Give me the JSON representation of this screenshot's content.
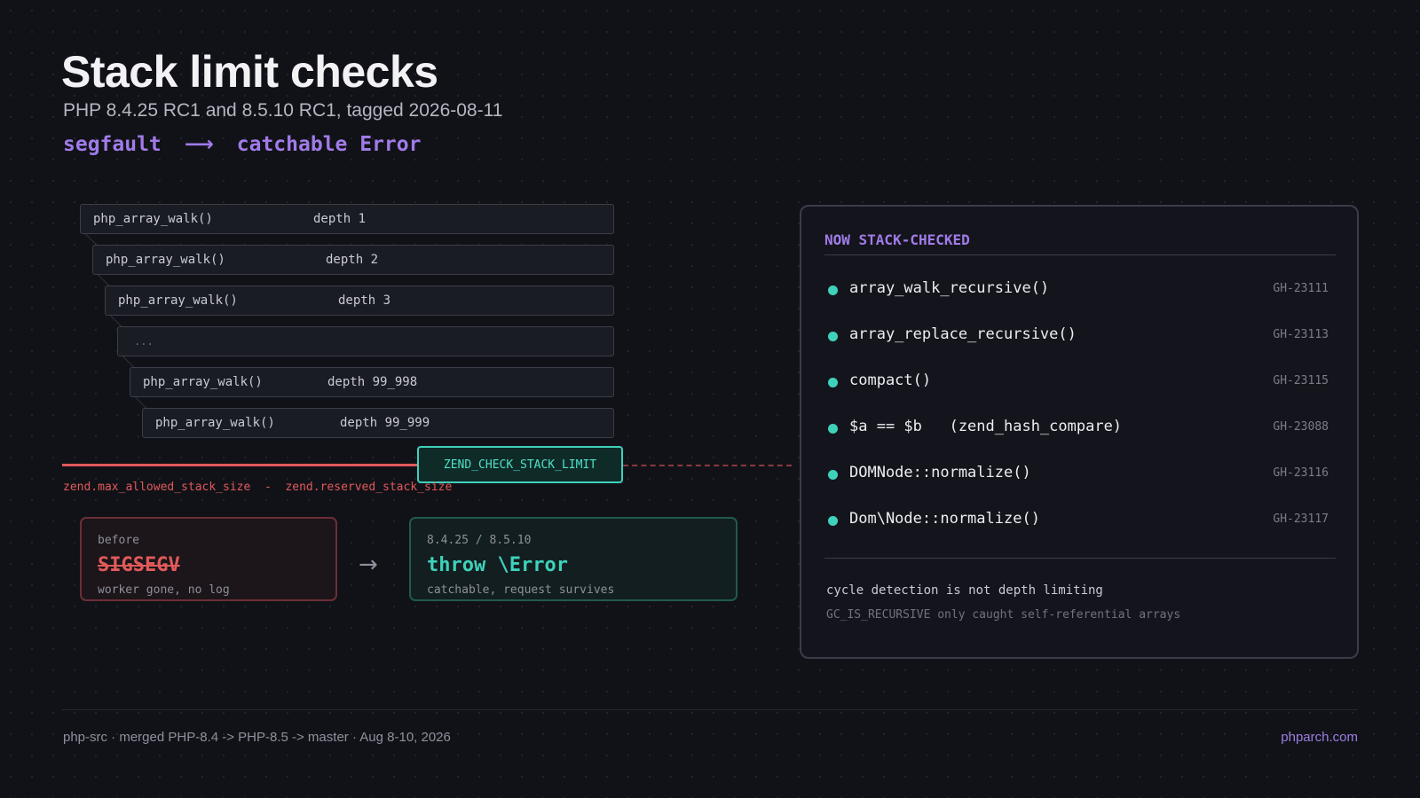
{
  "header": {
    "title": "Stack limit checks",
    "subtitle": "PHP 8.4.25 RC1 and 8.5.10 RC1, tagged 2026-08-11",
    "tagline_from": "segfault",
    "tagline_to": "catchable Error"
  },
  "stack": {
    "frames": [
      {
        "fn": "php_array_walk()",
        "depth": "depth 1"
      },
      {
        "fn": "php_array_walk()",
        "depth": "depth 2"
      },
      {
        "fn": "php_array_walk()",
        "depth": "depth 3"
      },
      {
        "fn": "...",
        "depth": ""
      },
      {
        "fn": "php_array_walk()",
        "depth": "depth 99_998"
      },
      {
        "fn": "php_array_walk()",
        "depth": "depth 99_999"
      }
    ]
  },
  "limit": {
    "label": "ZEND_CHECK_STACK_LIMIT",
    "formula": "zend.max_allowed_stack_size  -  zend.reserved_stack_size"
  },
  "before": {
    "label": "before",
    "value": "SIGSEGV",
    "note": "worker gone, no log"
  },
  "after": {
    "label": "8.4.25 / 8.5.10",
    "value": "throw \\Error",
    "note": "catchable, request survives"
  },
  "panel": {
    "title": "NOW STACK-CHECKED",
    "items": [
      {
        "name": "array_walk_recursive()",
        "ref": "GH-23111"
      },
      {
        "name": "array_replace_recursive()",
        "ref": "GH-23113"
      },
      {
        "name": "compact()",
        "ref": "GH-23115"
      },
      {
        "name": "$a == $b   (zend_hash_compare)",
        "ref": "GH-23088"
      },
      {
        "name": "DOMNode::normalize()",
        "ref": "GH-23116"
      },
      {
        "name": "Dom\\Node::normalize()",
        "ref": "GH-23117"
      }
    ],
    "note_main": "cycle detection is not depth limiting",
    "note_sub": "GC_IS_RECURSIVE only caught self-referential arrays"
  },
  "footer": {
    "left": "php-src  ·  merged PHP-8.4 -> PHP-8.5 -> master  ·  Aug 8-10, 2026",
    "right": "phparch.com"
  },
  "colors": {
    "background": "#111218",
    "accent_purple": "#a07be8",
    "accent_teal": "#3fd1bb",
    "danger_red": "#e05a5a"
  }
}
